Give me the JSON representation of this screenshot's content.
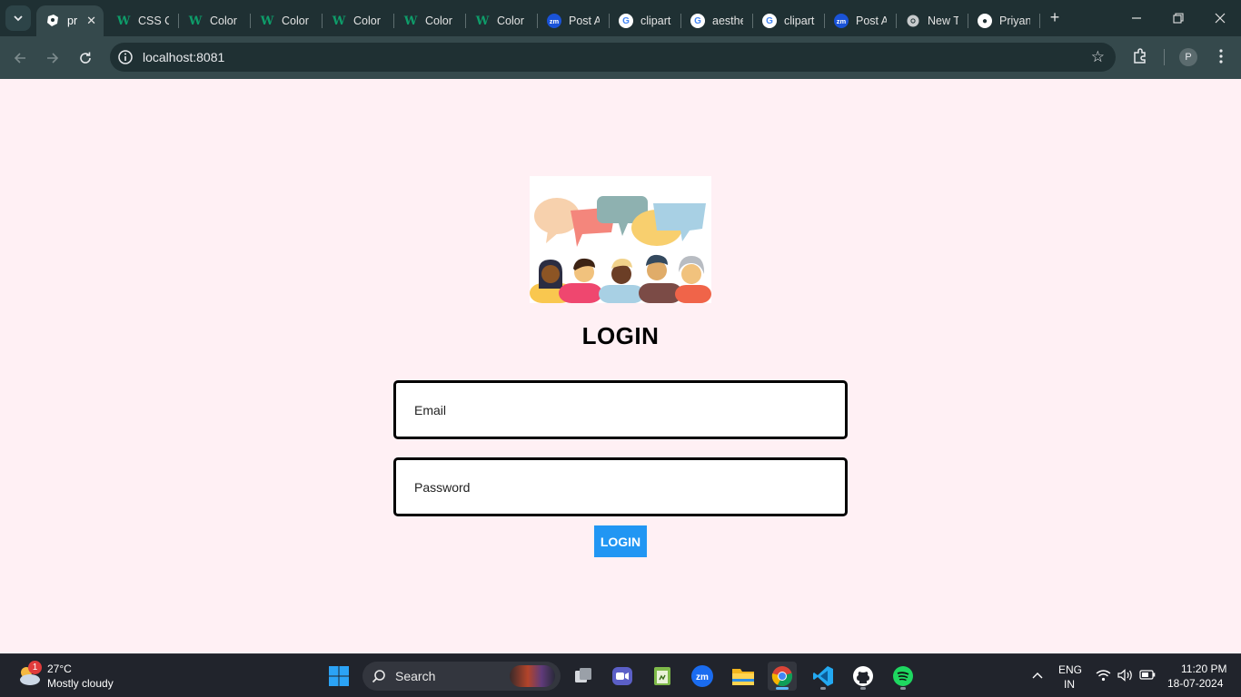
{
  "browser": {
    "tabs": [
      {
        "title": "pr",
        "favicon": "project-icon",
        "active": true
      },
      {
        "title": "CSS C",
        "favicon": "w-icon"
      },
      {
        "title": "Color",
        "favicon": "w-icon"
      },
      {
        "title": "Color",
        "favicon": "w-icon"
      },
      {
        "title": "Color",
        "favicon": "w-icon"
      },
      {
        "title": "Color",
        "favicon": "w-icon"
      },
      {
        "title": "Color",
        "favicon": "w-icon"
      },
      {
        "title": "Post A",
        "favicon": "zoom-icon"
      },
      {
        "title": "clipart",
        "favicon": "google-icon"
      },
      {
        "title": "aesthe",
        "favicon": "google-icon"
      },
      {
        "title": "clipart",
        "favicon": "google-icon"
      },
      {
        "title": "Post A",
        "favicon": "zoom-icon"
      },
      {
        "title": "New T",
        "favicon": "chrome-icon"
      },
      {
        "title": "Priyan",
        "favicon": "github-icon"
      }
    ],
    "address": "localhost:8081",
    "profile_initial": "P"
  },
  "page": {
    "title": "LOGIN",
    "email_placeholder": "Email",
    "password_placeholder": "Password",
    "login_button": "LOGIN",
    "background_color": "#fff0f4",
    "button_color": "#2196f3"
  },
  "taskbar": {
    "weather": {
      "temp": "27°C",
      "desc": "Mostly cloudy",
      "badge": "1"
    },
    "search_label": "Search",
    "apps": [
      "windows-start-icon",
      "task-view-icon",
      "zoom-video-icon",
      "notepad-icon",
      "zoom-icon",
      "file-explorer-icon",
      "chrome-icon",
      "vscode-icon",
      "github-desktop-icon",
      "spotify-icon"
    ],
    "lang_top": "ENG",
    "lang_bottom": "IN",
    "time": "11:20 PM",
    "date": "18-07-2024"
  }
}
